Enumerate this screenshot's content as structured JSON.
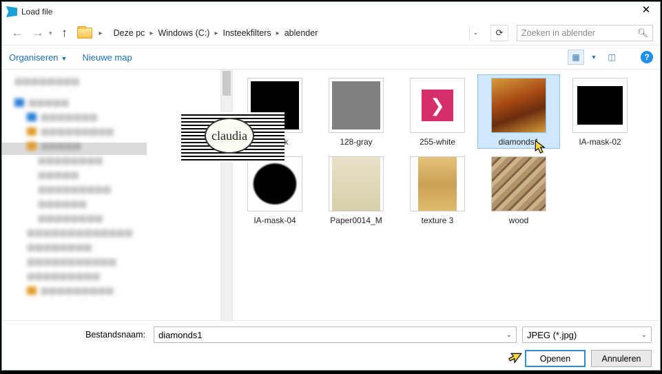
{
  "window": {
    "title": "Load file"
  },
  "breadcrumb": {
    "root": "Deze pc",
    "drive": "Windows (C:)",
    "folder1": "Insteekfilters",
    "folder2": "ablender"
  },
  "search": {
    "placeholder": "Zoeken in ablender"
  },
  "toolbar": {
    "organize": "Organiseren",
    "newfolder": "Nieuwe map"
  },
  "files": {
    "f0": "0-black",
    "f1": "128-gray",
    "f2": "255-white",
    "f3": "diamonds1",
    "f4": "IA-mask-02",
    "f5": "IA-mask-04",
    "f6": "Paper0014_M",
    "f7": "texture 3",
    "f8": "wood"
  },
  "watermark": "claudia",
  "footer": {
    "filename_label": "Bestandsnaam:",
    "filename_value": "diamonds1",
    "filetype_value": "JPEG (*.jpg)",
    "open": "Openen",
    "cancel": "Annuleren"
  }
}
